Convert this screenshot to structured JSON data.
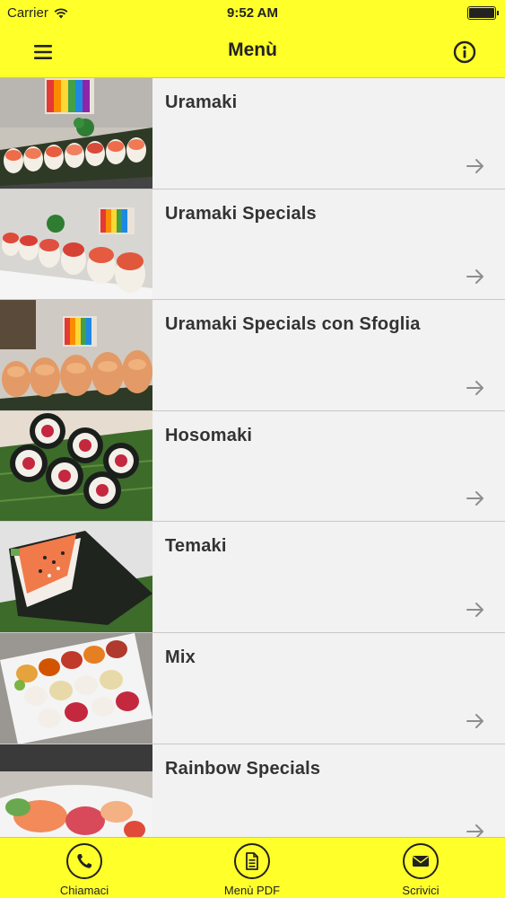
{
  "status_bar": {
    "carrier": "Carrier",
    "time": "9:52 AM"
  },
  "nav": {
    "title": "Menù",
    "menu_icon": "hamburger-icon",
    "info_icon": "info-icon"
  },
  "menu_items": [
    {
      "label": "Uramaki",
      "image": "uramaki-photo"
    },
    {
      "label": "Uramaki Specials",
      "image": "uramaki-specials-photo"
    },
    {
      "label": "Uramaki Specials con Sfoglia",
      "image": "uramaki-sfoglia-photo"
    },
    {
      "label": "Hosomaki",
      "image": "hosomaki-photo"
    },
    {
      "label": "Temaki",
      "image": "temaki-photo"
    },
    {
      "label": "Mix",
      "image": "mix-photo"
    },
    {
      "label": "Rainbow Specials",
      "image": "rainbow-specials-photo"
    }
  ],
  "tab_bar": [
    {
      "label": "Chiamaci",
      "icon": "phone-icon"
    },
    {
      "label": "Menù PDF",
      "icon": "document-icon"
    },
    {
      "label": "Scrivici",
      "icon": "envelope-icon"
    }
  ],
  "colors": {
    "accent": "#ffff2a",
    "text": "#333333",
    "arrow": "#8e8e8e"
  }
}
